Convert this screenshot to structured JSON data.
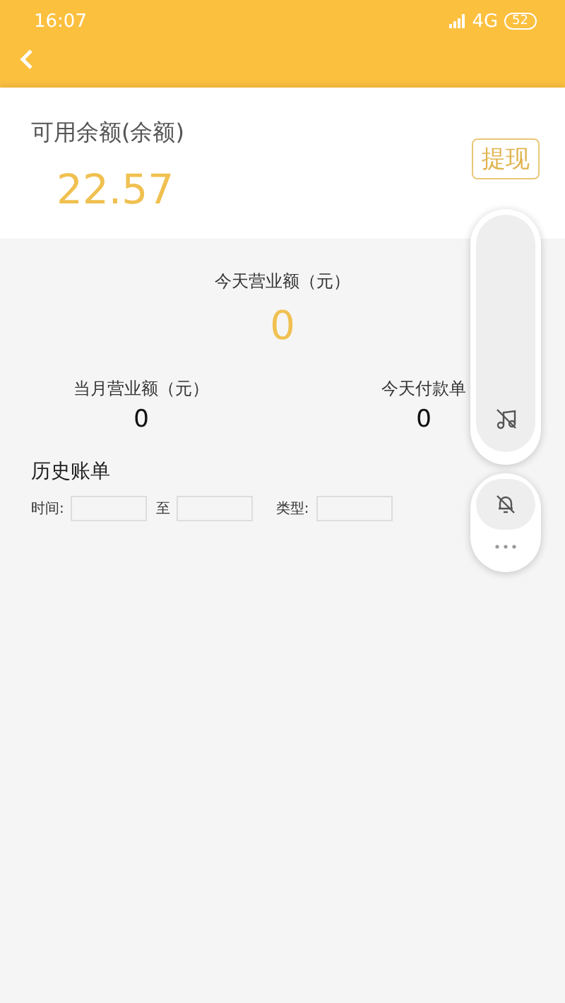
{
  "status_bar": {
    "time": "16:07",
    "network": "4G",
    "battery": "52"
  },
  "balance": {
    "label": "可用余额(余额)",
    "amount": "22.57",
    "withdraw_button": "提现"
  },
  "today": {
    "label": "今天营业额（元）",
    "value": "0"
  },
  "stats": [
    {
      "label": "当月营业额（元）",
      "value": "0"
    },
    {
      "label": "今天付款单",
      "value": "0"
    }
  ],
  "history": {
    "title": "历史账单",
    "filters": [
      {
        "label": "时间:"
      },
      {
        "label": "至"
      },
      {
        "label": "类型:"
      }
    ]
  },
  "volume_panel": {
    "level": 0
  }
}
